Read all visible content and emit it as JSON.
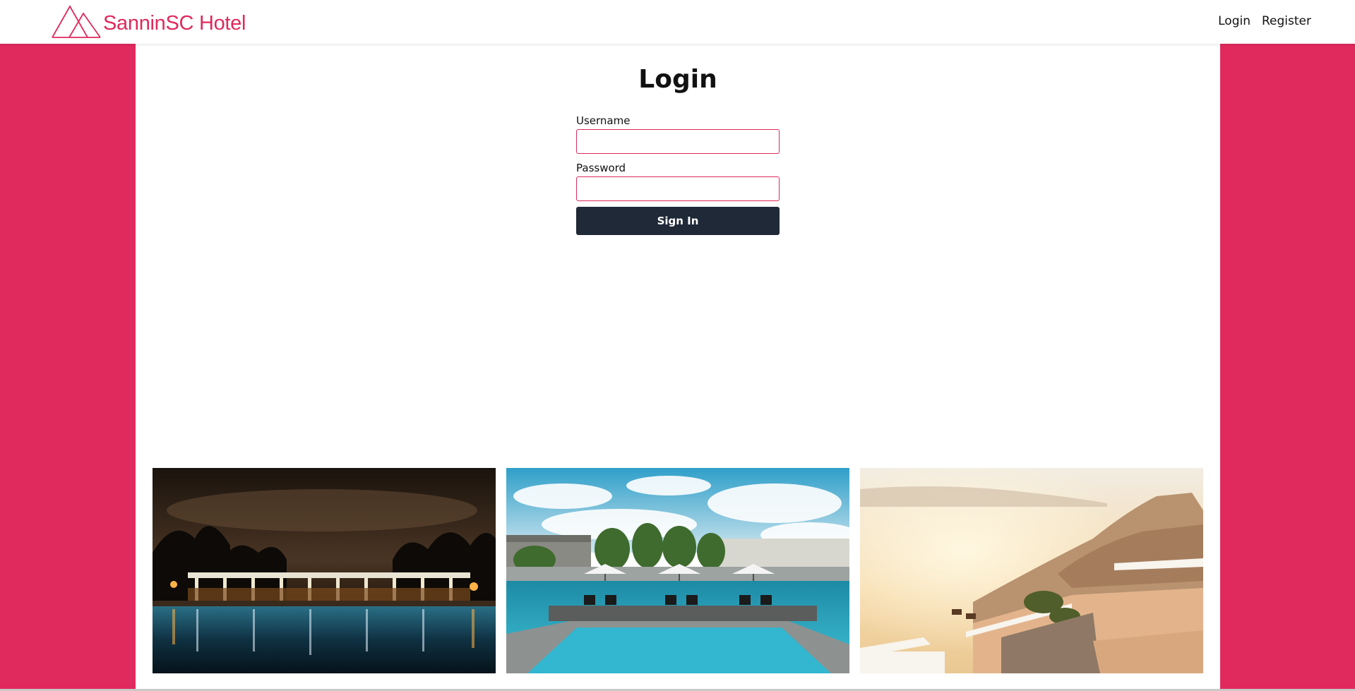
{
  "navbar": {
    "brand_name": "SanninSC Hotel",
    "brand_icon": "mountain-logo-icon",
    "links": {
      "login": "Login",
      "register": "Register"
    }
  },
  "login": {
    "title": "Login",
    "username_label": "Username",
    "username_value": "",
    "password_label": "Password",
    "password_value": "",
    "submit_label": "Sign In"
  },
  "gallery": {
    "photos": [
      {
        "name": "night-pool-photo"
      },
      {
        "name": "day-pool-photo"
      },
      {
        "name": "sea-terrace-photo"
      }
    ]
  },
  "colors": {
    "accent": "#e0295c",
    "button": "#1f2937",
    "panel": "#ffffff"
  }
}
